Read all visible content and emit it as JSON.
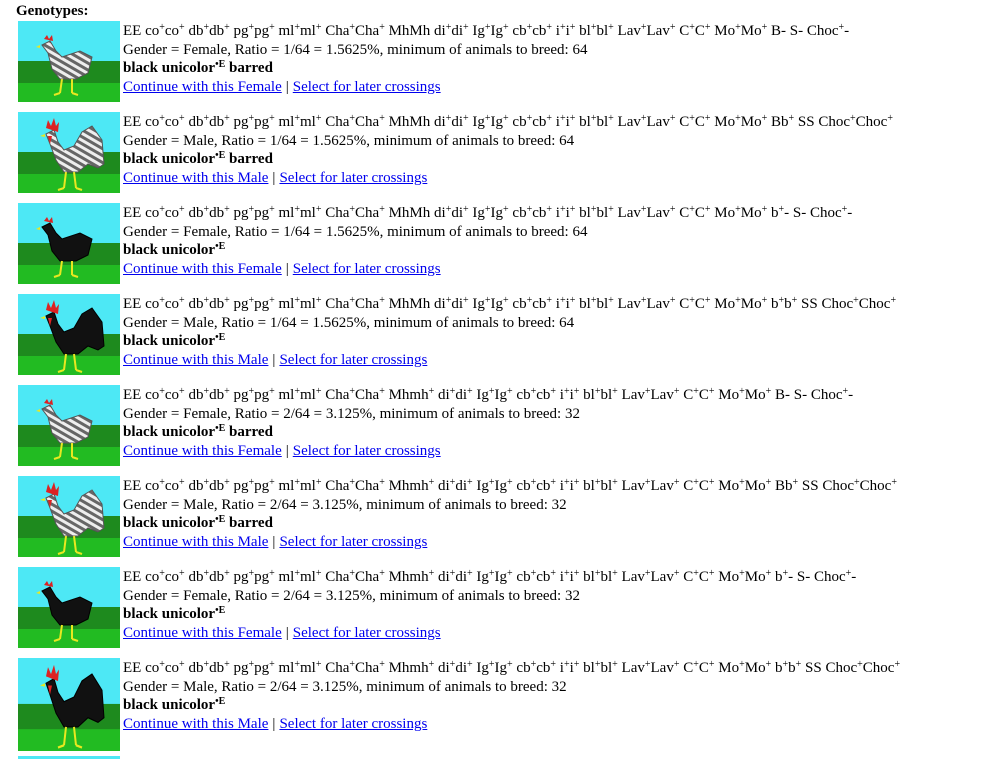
{
  "heading": "Genotypes:",
  "links": {
    "select": "Select for later crossings",
    "separator": "|"
  },
  "entries": [
    {
      "sex": "female",
      "plumage": "barred",
      "geno": [
        [
          "EE co",
          "+"
        ],
        [
          "co",
          "+"
        ],
        [
          " db",
          "+"
        ],
        [
          "db",
          "+"
        ],
        [
          " pg",
          "+"
        ],
        [
          "pg",
          "+"
        ],
        [
          " ml",
          "+"
        ],
        [
          "ml",
          "+"
        ],
        [
          " Cha",
          "+"
        ],
        [
          "Cha",
          "+"
        ],
        [
          " MhMh di",
          "+"
        ],
        [
          "di",
          "+"
        ],
        [
          " Ig",
          "+"
        ],
        [
          "Ig",
          "+"
        ],
        [
          " cb",
          "+"
        ],
        [
          "cb",
          "+"
        ],
        [
          " i",
          "+"
        ],
        [
          "i",
          "+"
        ],
        [
          " bl",
          "+"
        ],
        [
          "bl",
          "+"
        ],
        [
          " Lav",
          "+"
        ],
        [
          "Lav",
          "+"
        ],
        [
          " C",
          "+"
        ],
        [
          "C",
          "+"
        ],
        [
          " Mo",
          "+"
        ],
        [
          "Mo",
          "+"
        ],
        [
          " B- S- Choc",
          "+"
        ],
        [
          "-",
          ""
        ]
      ],
      "gender": "Gender = Female, Ratio = 1/64 = 1.5625%, minimum of animals to breed: 64",
      "pheno": "black unicolor",
      "pheno_sup": "•E",
      "pheno_extra": " barred",
      "continue": "Continue with this Female"
    },
    {
      "sex": "male",
      "plumage": "barred",
      "geno": [
        [
          "EE co",
          "+"
        ],
        [
          "co",
          "+"
        ],
        [
          " db",
          "+"
        ],
        [
          "db",
          "+"
        ],
        [
          " pg",
          "+"
        ],
        [
          "pg",
          "+"
        ],
        [
          " ml",
          "+"
        ],
        [
          "ml",
          "+"
        ],
        [
          " Cha",
          "+"
        ],
        [
          "Cha",
          "+"
        ],
        [
          " MhMh di",
          "+"
        ],
        [
          "di",
          "+"
        ],
        [
          " Ig",
          "+"
        ],
        [
          "Ig",
          "+"
        ],
        [
          " cb",
          "+"
        ],
        [
          "cb",
          "+"
        ],
        [
          " i",
          "+"
        ],
        [
          "i",
          "+"
        ],
        [
          " bl",
          "+"
        ],
        [
          "bl",
          "+"
        ],
        [
          " Lav",
          "+"
        ],
        [
          "Lav",
          "+"
        ],
        [
          " C",
          "+"
        ],
        [
          "C",
          "+"
        ],
        [
          " Mo",
          "+"
        ],
        [
          "Mo",
          "+"
        ],
        [
          " Bb",
          "+"
        ],
        [
          " SS Choc",
          "+"
        ],
        [
          "Choc",
          "+"
        ]
      ],
      "gender": "Gender = Male, Ratio = 1/64 = 1.5625%, minimum of animals to breed: 64",
      "pheno": "black unicolor",
      "pheno_sup": "•E",
      "pheno_extra": " barred",
      "continue": "Continue with this Male"
    },
    {
      "sex": "female",
      "plumage": "black",
      "geno": [
        [
          "EE co",
          "+"
        ],
        [
          "co",
          "+"
        ],
        [
          " db",
          "+"
        ],
        [
          "db",
          "+"
        ],
        [
          " pg",
          "+"
        ],
        [
          "pg",
          "+"
        ],
        [
          " ml",
          "+"
        ],
        [
          "ml",
          "+"
        ],
        [
          " Cha",
          "+"
        ],
        [
          "Cha",
          "+"
        ],
        [
          " MhMh di",
          "+"
        ],
        [
          "di",
          "+"
        ],
        [
          " Ig",
          "+"
        ],
        [
          "Ig",
          "+"
        ],
        [
          " cb",
          "+"
        ],
        [
          "cb",
          "+"
        ],
        [
          " i",
          "+"
        ],
        [
          "i",
          "+"
        ],
        [
          " bl",
          "+"
        ],
        [
          "bl",
          "+"
        ],
        [
          " Lav",
          "+"
        ],
        [
          "Lav",
          "+"
        ],
        [
          " C",
          "+"
        ],
        [
          "C",
          "+"
        ],
        [
          " Mo",
          "+"
        ],
        [
          "Mo",
          "+"
        ],
        [
          " b",
          "+"
        ],
        [
          "- S- Choc",
          "+"
        ],
        [
          "-",
          ""
        ]
      ],
      "gender": "Gender = Female, Ratio = 1/64 = 1.5625%, minimum of animals to breed: 64",
      "pheno": "black unicolor",
      "pheno_sup": "•E",
      "pheno_extra": "",
      "continue": "Continue with this Female"
    },
    {
      "sex": "male",
      "plumage": "black",
      "geno": [
        [
          "EE co",
          "+"
        ],
        [
          "co",
          "+"
        ],
        [
          " db",
          "+"
        ],
        [
          "db",
          "+"
        ],
        [
          " pg",
          "+"
        ],
        [
          "pg",
          "+"
        ],
        [
          " ml",
          "+"
        ],
        [
          "ml",
          "+"
        ],
        [
          " Cha",
          "+"
        ],
        [
          "Cha",
          "+"
        ],
        [
          " MhMh di",
          "+"
        ],
        [
          "di",
          "+"
        ],
        [
          " Ig",
          "+"
        ],
        [
          "Ig",
          "+"
        ],
        [
          " cb",
          "+"
        ],
        [
          "cb",
          "+"
        ],
        [
          " i",
          "+"
        ],
        [
          "i",
          "+"
        ],
        [
          " bl",
          "+"
        ],
        [
          "bl",
          "+"
        ],
        [
          " Lav",
          "+"
        ],
        [
          "Lav",
          "+"
        ],
        [
          " C",
          "+"
        ],
        [
          "C",
          "+"
        ],
        [
          " Mo",
          "+"
        ],
        [
          "Mo",
          "+"
        ],
        [
          " b",
          "+"
        ],
        [
          "b",
          "+"
        ],
        [
          " SS Choc",
          "+"
        ],
        [
          "Choc",
          "+"
        ]
      ],
      "gender": "Gender = Male, Ratio = 1/64 = 1.5625%, minimum of animals to breed: 64",
      "pheno": "black unicolor",
      "pheno_sup": "•E",
      "pheno_extra": "",
      "continue": "Continue with this Male"
    },
    {
      "sex": "female",
      "plumage": "barred",
      "geno": [
        [
          "EE co",
          "+"
        ],
        [
          "co",
          "+"
        ],
        [
          " db",
          "+"
        ],
        [
          "db",
          "+"
        ],
        [
          " pg",
          "+"
        ],
        [
          "pg",
          "+"
        ],
        [
          " ml",
          "+"
        ],
        [
          "ml",
          "+"
        ],
        [
          " Cha",
          "+"
        ],
        [
          "Cha",
          "+"
        ],
        [
          " Mhmh",
          "+"
        ],
        [
          " di",
          "+"
        ],
        [
          "di",
          "+"
        ],
        [
          " Ig",
          "+"
        ],
        [
          "Ig",
          "+"
        ],
        [
          " cb",
          "+"
        ],
        [
          "cb",
          "+"
        ],
        [
          " i",
          "+"
        ],
        [
          "i",
          "+"
        ],
        [
          " bl",
          "+"
        ],
        [
          "bl",
          "+"
        ],
        [
          " Lav",
          "+"
        ],
        [
          "Lav",
          "+"
        ],
        [
          " C",
          "+"
        ],
        [
          "C",
          "+"
        ],
        [
          " Mo",
          "+"
        ],
        [
          "Mo",
          "+"
        ],
        [
          " B- S- Choc",
          "+"
        ],
        [
          "-",
          ""
        ]
      ],
      "gender": "Gender = Female, Ratio = 2/64 = 3.125%, minimum of animals to breed: 32",
      "pheno": "black unicolor",
      "pheno_sup": "•E",
      "pheno_extra": " barred",
      "continue": "Continue with this Female"
    },
    {
      "sex": "male",
      "plumage": "barred",
      "geno": [
        [
          "EE co",
          "+"
        ],
        [
          "co",
          "+"
        ],
        [
          " db",
          "+"
        ],
        [
          "db",
          "+"
        ],
        [
          " pg",
          "+"
        ],
        [
          "pg",
          "+"
        ],
        [
          " ml",
          "+"
        ],
        [
          "ml",
          "+"
        ],
        [
          " Cha",
          "+"
        ],
        [
          "Cha",
          "+"
        ],
        [
          " Mhmh",
          "+"
        ],
        [
          " di",
          "+"
        ],
        [
          "di",
          "+"
        ],
        [
          " Ig",
          "+"
        ],
        [
          "Ig",
          "+"
        ],
        [
          " cb",
          "+"
        ],
        [
          "cb",
          "+"
        ],
        [
          " i",
          "+"
        ],
        [
          "i",
          "+"
        ],
        [
          " bl",
          "+"
        ],
        [
          "bl",
          "+"
        ],
        [
          " Lav",
          "+"
        ],
        [
          "Lav",
          "+"
        ],
        [
          " C",
          "+"
        ],
        [
          "C",
          "+"
        ],
        [
          " Mo",
          "+"
        ],
        [
          "Mo",
          "+"
        ],
        [
          " Bb",
          "+"
        ],
        [
          " SS Choc",
          "+"
        ],
        [
          "Choc",
          "+"
        ]
      ],
      "gender": "Gender = Male, Ratio = 2/64 = 3.125%, minimum of animals to breed: 32",
      "pheno": "black unicolor",
      "pheno_sup": "•E",
      "pheno_extra": " barred",
      "continue": "Continue with this Male"
    },
    {
      "sex": "female",
      "plumage": "black",
      "geno": [
        [
          "EE co",
          "+"
        ],
        [
          "co",
          "+"
        ],
        [
          " db",
          "+"
        ],
        [
          "db",
          "+"
        ],
        [
          " pg",
          "+"
        ],
        [
          "pg",
          "+"
        ],
        [
          " ml",
          "+"
        ],
        [
          "ml",
          "+"
        ],
        [
          " Cha",
          "+"
        ],
        [
          "Cha",
          "+"
        ],
        [
          " Mhmh",
          "+"
        ],
        [
          " di",
          "+"
        ],
        [
          "di",
          "+"
        ],
        [
          " Ig",
          "+"
        ],
        [
          "Ig",
          "+"
        ],
        [
          " cb",
          "+"
        ],
        [
          "cb",
          "+"
        ],
        [
          " i",
          "+"
        ],
        [
          "i",
          "+"
        ],
        [
          " bl",
          "+"
        ],
        [
          "bl",
          "+"
        ],
        [
          " Lav",
          "+"
        ],
        [
          "Lav",
          "+"
        ],
        [
          " C",
          "+"
        ],
        [
          "C",
          "+"
        ],
        [
          " Mo",
          "+"
        ],
        [
          "Mo",
          "+"
        ],
        [
          " b",
          "+"
        ],
        [
          "- S- Choc",
          "+"
        ],
        [
          "-",
          ""
        ]
      ],
      "gender": "Gender = Female, Ratio = 2/64 = 3.125%, minimum of animals to breed: 32",
      "pheno": "black unicolor",
      "pheno_sup": "•E",
      "pheno_extra": "",
      "continue": "Continue with this Female"
    },
    {
      "sex": "male",
      "plumage": "black",
      "geno": [
        [
          "EE co",
          "+"
        ],
        [
          "co",
          "+"
        ],
        [
          " db",
          "+"
        ],
        [
          "db",
          "+"
        ],
        [
          " pg",
          "+"
        ],
        [
          "pg",
          "+"
        ],
        [
          " ml",
          "+"
        ],
        [
          "ml",
          "+"
        ],
        [
          " Cha",
          "+"
        ],
        [
          "Cha",
          "+"
        ],
        [
          " Mhmh",
          "+"
        ],
        [
          " di",
          "+"
        ],
        [
          "di",
          "+"
        ],
        [
          " Ig",
          "+"
        ],
        [
          "Ig",
          "+"
        ],
        [
          " cb",
          "+"
        ],
        [
          "cb",
          "+"
        ],
        [
          " i",
          "+"
        ],
        [
          "i",
          "+"
        ],
        [
          " bl",
          "+"
        ],
        [
          "bl",
          "+"
        ],
        [
          " Lav",
          "+"
        ],
        [
          "Lav",
          "+"
        ],
        [
          " C",
          "+"
        ],
        [
          "C",
          "+"
        ],
        [
          " Mo",
          "+"
        ],
        [
          "Mo",
          "+"
        ],
        [
          " b",
          "+"
        ],
        [
          "b",
          "+"
        ],
        [
          " SS Choc",
          "+"
        ],
        [
          "Choc",
          "+"
        ]
      ],
      "gender": "Gender = Male, Ratio = 2/64 = 3.125%, minimum of animals to breed: 32",
      "pheno": "black unicolor",
      "pheno_sup": "•E",
      "pheno_extra": "",
      "continue": "Continue with this Male"
    }
  ],
  "colors": {
    "sky": "#4de8f5",
    "grass_dark": "#1e8a1e",
    "grass_light": "#22bb22",
    "link": "#0000ee",
    "comb": "#dd2222",
    "legs": "#e8e820"
  }
}
